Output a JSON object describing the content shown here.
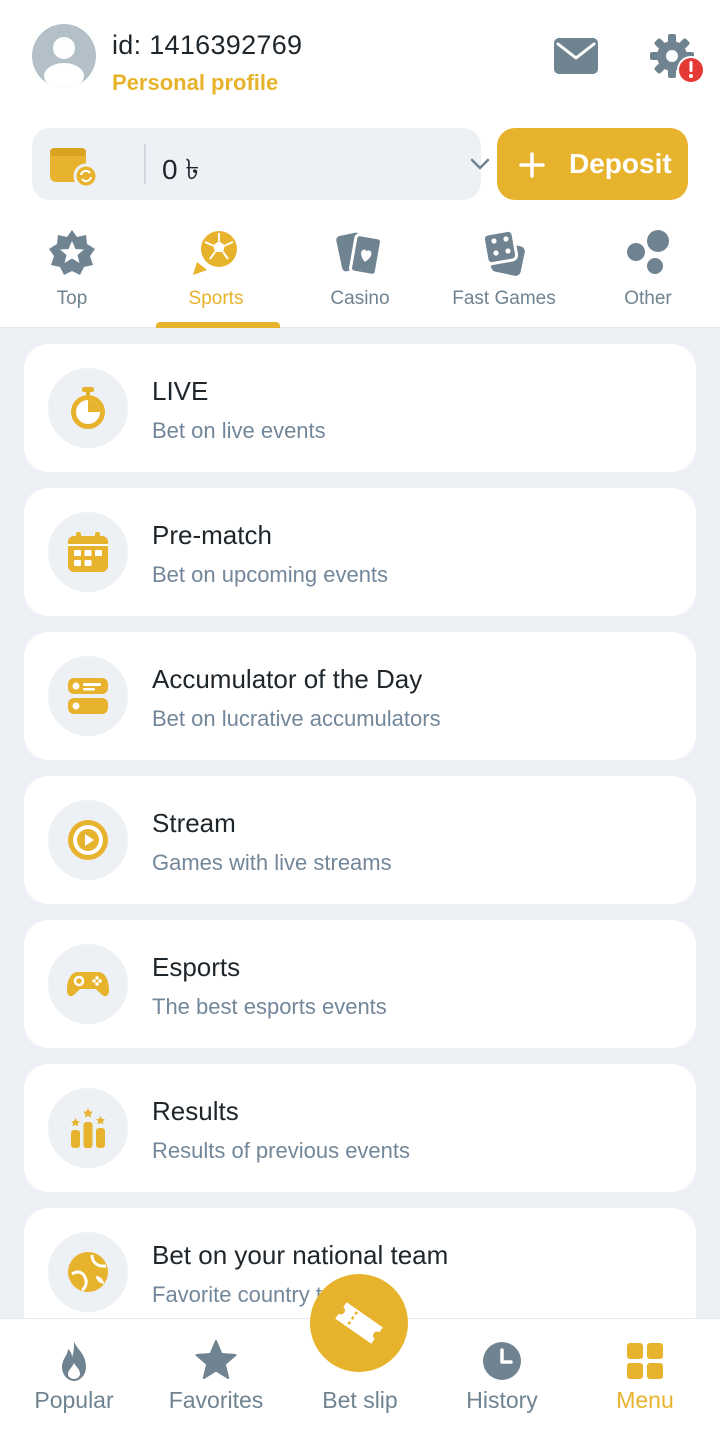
{
  "header": {
    "user_id": "id: 1416392769",
    "profile_link": "Personal profile",
    "has_alert": true
  },
  "balance": {
    "amount": "0 ৳",
    "deposit_label": "Deposit"
  },
  "tabs": [
    {
      "label": "Top",
      "icon": "star-badge-icon",
      "active": false
    },
    {
      "label": "Sports",
      "icon": "soccer-ball-icon",
      "active": true
    },
    {
      "label": "Casino",
      "icon": "playing-cards-icon",
      "active": false
    },
    {
      "label": "Fast Games",
      "icon": "dice-icon",
      "active": false
    },
    {
      "label": "Other",
      "icon": "bubbles-icon",
      "active": false
    }
  ],
  "menu_items": [
    {
      "title": "LIVE",
      "subtitle": "Bet on live events",
      "icon": "stopwatch-icon"
    },
    {
      "title": "Pre-match",
      "subtitle": "Bet on upcoming events",
      "icon": "calendar-icon"
    },
    {
      "title": "Accumulator of the Day",
      "subtitle": "Bet on lucrative accumulators",
      "icon": "accumulator-icon"
    },
    {
      "title": "Stream",
      "subtitle": "Games with live streams",
      "icon": "play-icon"
    },
    {
      "title": "Esports",
      "subtitle": "The best esports events",
      "icon": "gamepad-icon"
    },
    {
      "title": "Results",
      "subtitle": "Results of previous events",
      "icon": "podium-icon"
    },
    {
      "title": "Bet on your national team",
      "subtitle": "Favorite country teams",
      "icon": "national-ball-icon"
    }
  ],
  "bottom_nav": [
    {
      "label": "Popular",
      "icon": "flame-icon",
      "active": false
    },
    {
      "label": "Favorites",
      "icon": "star-icon",
      "active": false
    },
    {
      "label": "Bet slip",
      "icon": "ticket-icon",
      "active": false
    },
    {
      "label": "History",
      "icon": "clock-icon",
      "active": false
    },
    {
      "label": "Menu",
      "icon": "grid-icon",
      "active": true
    }
  ],
  "colors": {
    "accent": "#e8b32c",
    "muted": "#6f8391",
    "text": "#1f262b",
    "background": "#eceff4",
    "alert": "#e53935"
  }
}
